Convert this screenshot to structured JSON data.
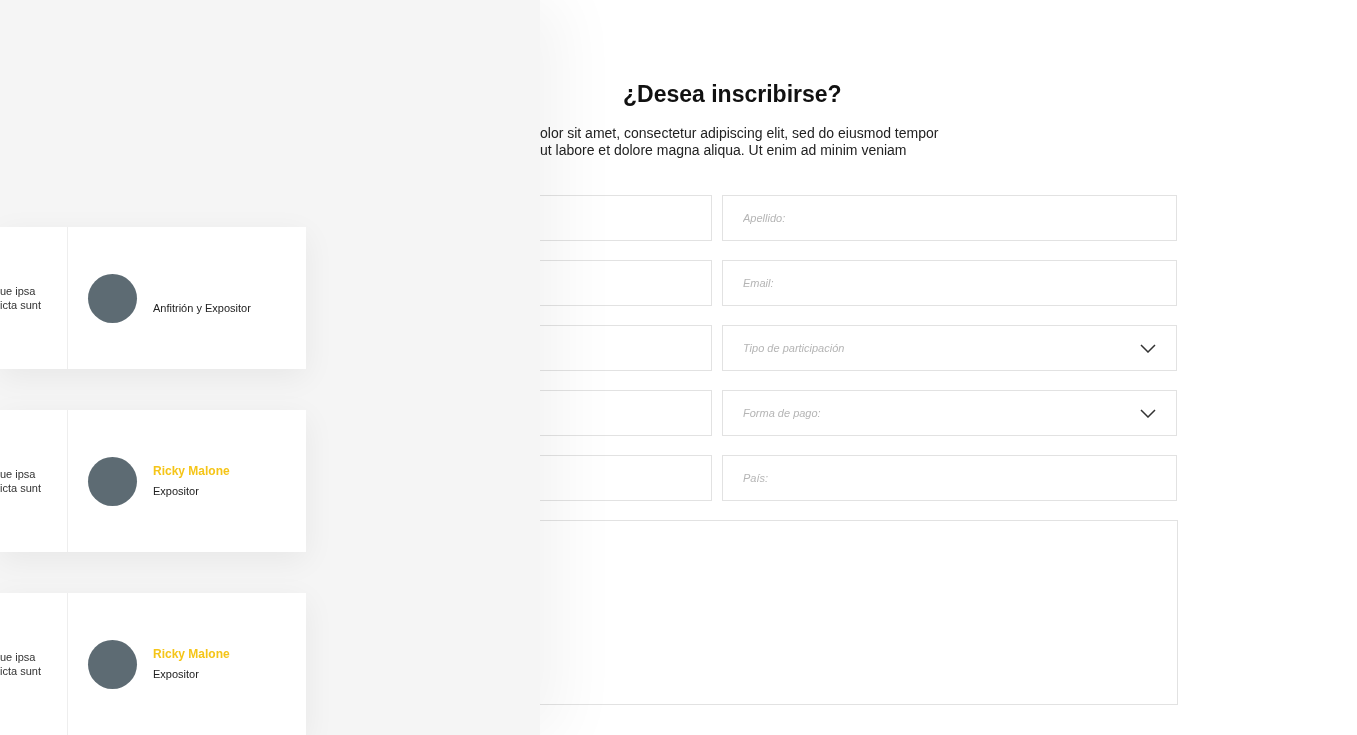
{
  "speakers": [
    {
      "description_lines": [
        "ue ipsa",
        "icta sunt"
      ],
      "role": "Anfitrión y Expositor"
    },
    {
      "description_lines": [
        "ue ipsa",
        "icta sunt"
      ],
      "name": "Ricky Malone",
      "role": "Expositor"
    },
    {
      "description_lines": [
        "ue ipsa",
        "icta sunt"
      ],
      "name": "Ricky Malone",
      "role": "Expositor"
    }
  ],
  "form": {
    "title": "¿Desea inscribirse?",
    "intro_lines": [
      "olor sit amet, consectetur adipiscing elit, sed do eiusmod tempor",
      "ut labore et dolore magna aliqua. Ut enim ad minim veniam"
    ],
    "rows": [
      {
        "left": {
          "kind": "text"
        },
        "right": {
          "kind": "text",
          "placeholder": "Apellido:"
        }
      },
      {
        "left": {
          "kind": "text"
        },
        "right": {
          "kind": "text",
          "placeholder": "Email:"
        }
      },
      {
        "left": {
          "kind": "text"
        },
        "right": {
          "kind": "select",
          "placeholder": "Tipo de participación"
        }
      },
      {
        "left": {
          "kind": "text"
        },
        "right": {
          "kind": "select",
          "placeholder": "Forma de pago:"
        }
      },
      {
        "left": {
          "kind": "text"
        },
        "right": {
          "kind": "text",
          "placeholder": "País:"
        }
      }
    ],
    "message": {
      "kind": "textarea"
    }
  }
}
